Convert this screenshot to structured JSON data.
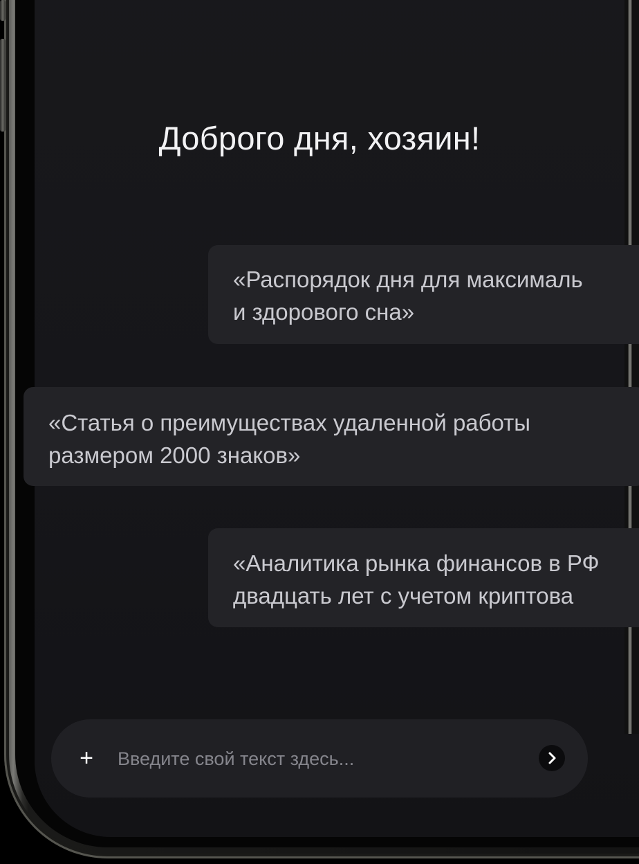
{
  "screen": {
    "greeting": "Доброго дня, хозяин!",
    "background_color": "#17171a"
  },
  "suggestions": [
    {
      "line1": "«Распорядок дня для максималь",
      "line2": "и здорового сна»"
    },
    {
      "line1": "«Статья о преимуществах удаленной работы",
      "line2": "размером 2000 знаков»"
    },
    {
      "line1": "«Аналитика рынка финансов в РФ",
      "line2": "двадцать лет с учетом криптова"
    }
  ],
  "composer": {
    "placeholder": "Введите свой текст здесь...",
    "value": "",
    "add_icon": "plus-icon",
    "send_icon": "chevron-right-icon"
  },
  "colors": {
    "bubble": "#232327",
    "composer": "#202024",
    "text_primary": "#f2f2f4",
    "text_secondary": "#c9c9cf"
  }
}
